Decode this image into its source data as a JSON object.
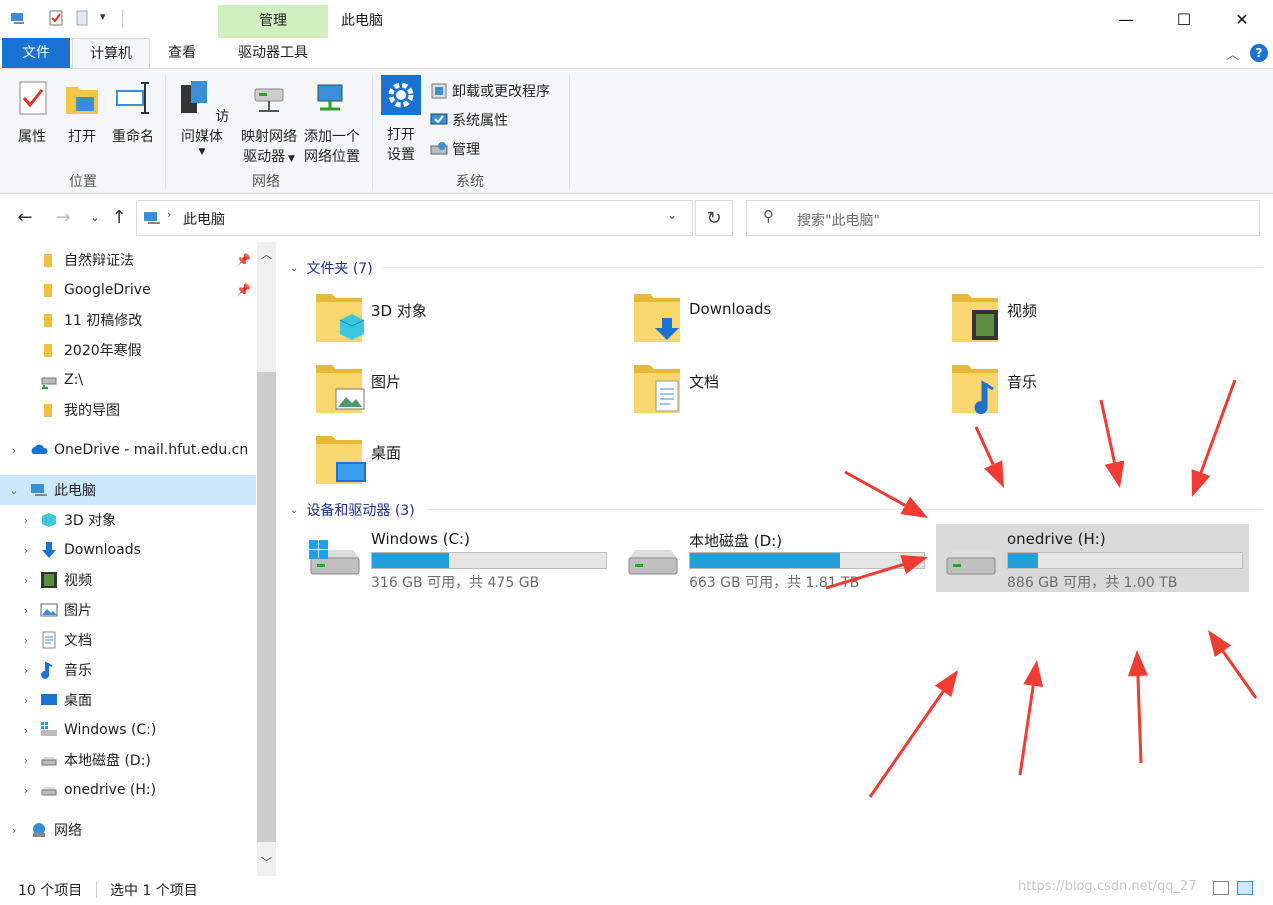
{
  "window": {
    "title": "此电脑",
    "context_tab": "管理",
    "controls": {
      "minimize": "—",
      "maximize": "☐",
      "close": "✕"
    }
  },
  "ribbon": {
    "tabs": {
      "file": "文件",
      "computer": "计算机",
      "view": "查看",
      "drive_tools": "驱动器工具"
    },
    "groups": {
      "location": {
        "label": "位置",
        "buttons": [
          "属性",
          "打开",
          "重命名"
        ]
      },
      "network": {
        "label": "网络",
        "access_media": "访问媒体",
        "map_drive_1": "映射网络",
        "map_drive_2": "驱动器",
        "add_location_1": "添加一个",
        "add_location_2": "网络位置"
      },
      "system": {
        "label": "系统",
        "open_settings_1": "打开",
        "open_settings_2": "设置",
        "uninstall": "卸载或更改程序",
        "sysprops": "系统属性",
        "manage": "管理"
      }
    }
  },
  "address": {
    "path": "此电脑",
    "search_placeholder": "搜索\"此电脑\""
  },
  "navpane": {
    "quick_access": [
      "自然辩证法",
      "GoogleDrive",
      "11 初稿修改",
      "2020年寒假",
      "Z:\\",
      "我的导图"
    ],
    "onedrive": "OneDrive - mail.hfut.edu.cn",
    "this_pc": "此电脑",
    "this_pc_children": [
      "3D 对象",
      "Downloads",
      "视频",
      "图片",
      "文档",
      "音乐",
      "桌面",
      "Windows (C:)",
      "本地磁盘 (D:)",
      "onedrive (H:)"
    ],
    "network": "网络"
  },
  "content": {
    "folders_header": "文件夹 (7)",
    "folders": [
      "3D 对象",
      "Downloads",
      "视频",
      "图片",
      "文档",
      "音乐",
      "桌面"
    ],
    "drives_header": "设备和驱动器 (3)",
    "drives": [
      {
        "name": "Windows (C:)",
        "size": "316 GB 可用，共 475 GB",
        "used_fraction": 0.33
      },
      {
        "name": "本地磁盘 (D:)",
        "size": "663 GB 可用，共 1.81 TB",
        "used_fraction": 0.64
      },
      {
        "name": "onedrive (H:)",
        "size": "886 GB 可用，共 1.00 TB",
        "used_fraction": 0.13
      }
    ]
  },
  "status": {
    "items": "10 个项目",
    "selected": "选中 1 个项目"
  },
  "watermark": "https://blog.csdn.net/qq_27",
  "colors": {
    "accent": "#1a72d3",
    "selection": "#cce8ff",
    "drivebar": "#26a0da",
    "arrow": "#f03c32"
  }
}
